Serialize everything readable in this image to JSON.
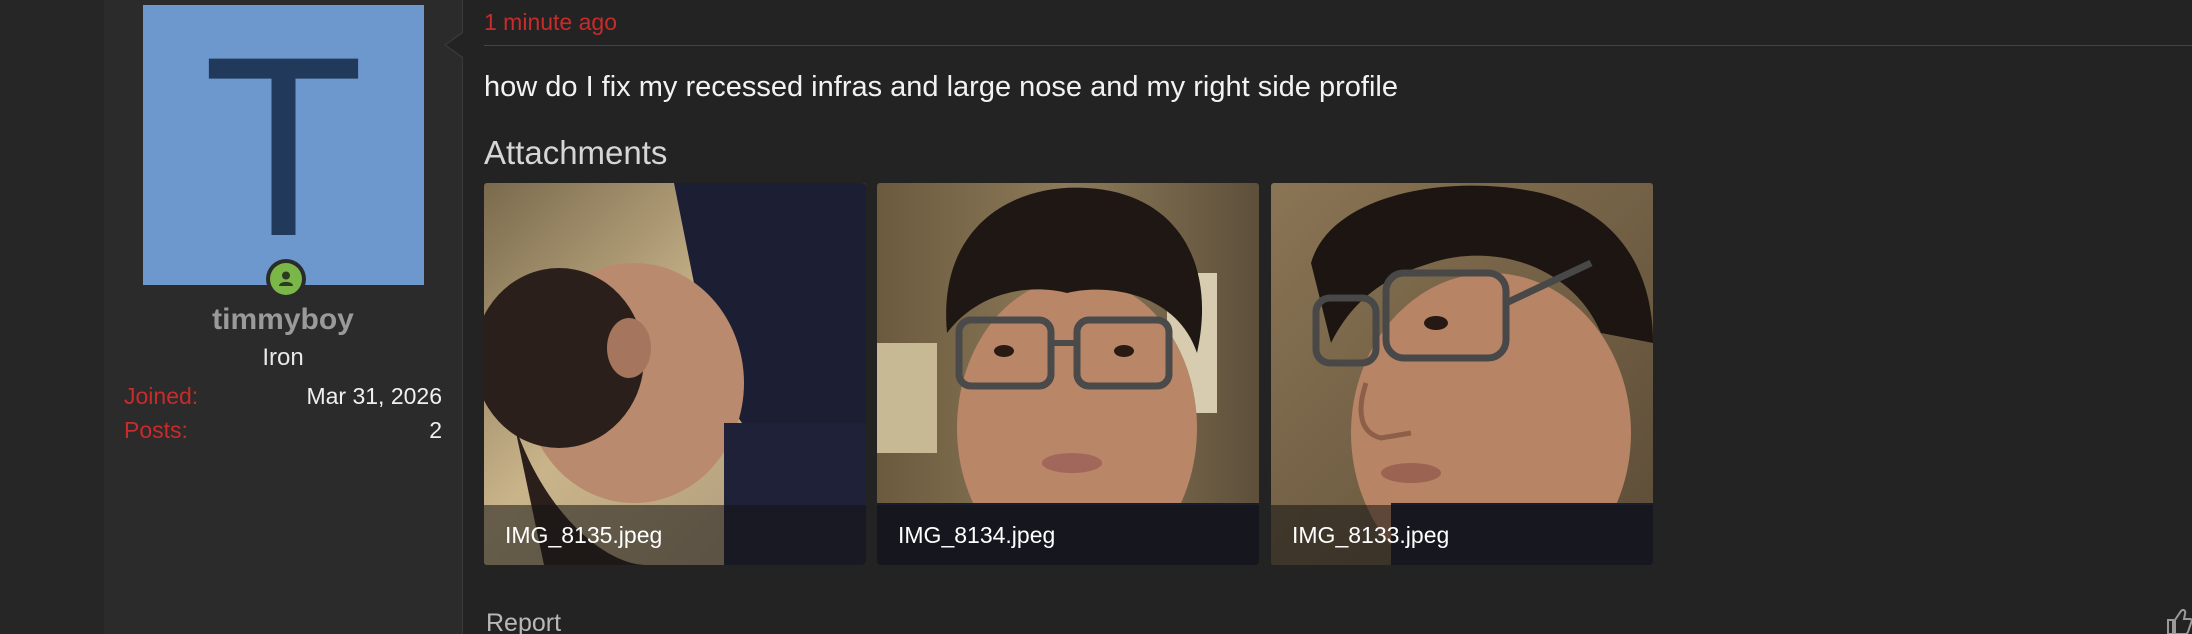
{
  "post": {
    "time": "1 minute ago",
    "message": "how do I fix my recessed infras and large nose and my right side profile",
    "attachments_title": "Attachments",
    "attachments": [
      {
        "filename": "IMG_8135.jpeg"
      },
      {
        "filename": "IMG_8134.jpeg"
      },
      {
        "filename": "IMG_8133.jpeg"
      }
    ],
    "report_label": "Report"
  },
  "author": {
    "avatar_letter": "T",
    "avatar_bg": "#6d98ce",
    "username": "timmyboy",
    "rank": "Iron",
    "stats": [
      {
        "label": "Joined:",
        "value": "Mar 31, 2026"
      },
      {
        "label": "Posts:",
        "value": "2"
      }
    ],
    "online": true
  },
  "colors": {
    "accent_red": "#c92b2b",
    "online_green": "#7ab648",
    "background": "#232323"
  },
  "icons": [
    "online-status-icon",
    "thumbs-up-icon"
  ]
}
